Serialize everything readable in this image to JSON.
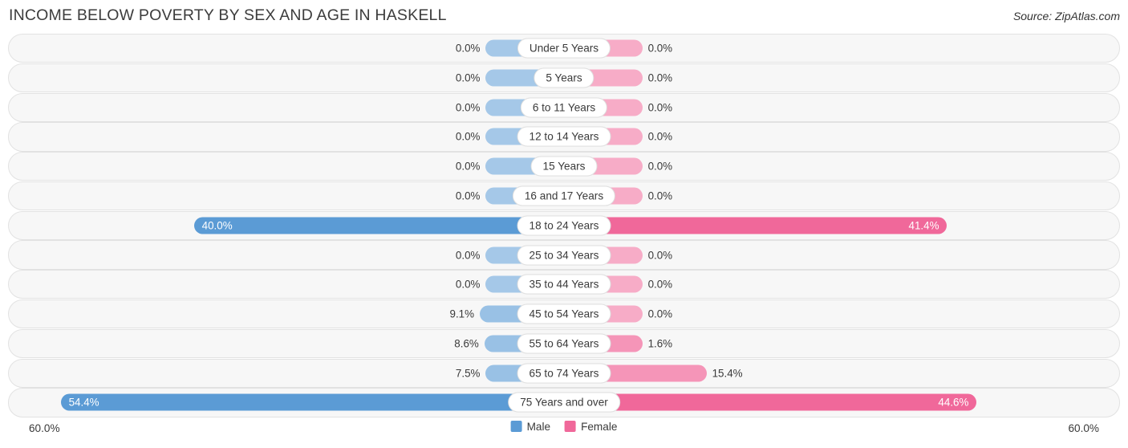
{
  "header": {
    "title": "Income Below Poverty by Sex and Age in Haskell",
    "source": "Source: ZipAtlas.com"
  },
  "axis": {
    "left_label": "60.0%",
    "right_label": "60.0%"
  },
  "legend": {
    "male": "Male",
    "female": "Female",
    "male_color": "#5b9bd5",
    "female_color": "#f0689a"
  },
  "chart_data": {
    "type": "bar",
    "title": "Income Below Poverty by Sex and Age in Haskell",
    "subtitle": "Source: ZipAtlas.com",
    "orientation": "horizontal-diverging",
    "xlabel": "",
    "ylabel": "",
    "xlim": [
      60.0,
      60.0
    ],
    "grid": false,
    "legend_position": "bottom-center",
    "categories": [
      "Under 5 Years",
      "5 Years",
      "6 to 11 Years",
      "12 to 14 Years",
      "15 Years",
      "16 and 17 Years",
      "18 to 24 Years",
      "25 to 34 Years",
      "35 to 44 Years",
      "45 to 54 Years",
      "55 to 64 Years",
      "65 to 74 Years",
      "75 Years and over"
    ],
    "series": [
      {
        "name": "Male",
        "color": "#5b9bd5",
        "values": [
          0.0,
          0.0,
          0.0,
          0.0,
          0.0,
          0.0,
          40.0,
          0.0,
          0.0,
          9.1,
          8.6,
          7.5,
          54.4
        ],
        "labels": [
          "0.0%",
          "0.0%",
          "0.0%",
          "0.0%",
          "0.0%",
          "0.0%",
          "40.0%",
          "0.0%",
          "0.0%",
          "9.1%",
          "8.6%",
          "7.5%",
          "54.4%"
        ]
      },
      {
        "name": "Female",
        "color": "#f0689a",
        "values": [
          0.0,
          0.0,
          0.0,
          0.0,
          0.0,
          0.0,
          41.4,
          0.0,
          0.0,
          0.0,
          1.6,
          15.4,
          44.6
        ],
        "labels": [
          "0.0%",
          "0.0%",
          "0.0%",
          "0.0%",
          "0.0%",
          "0.0%",
          "41.4%",
          "0.0%",
          "0.0%",
          "0.0%",
          "1.6%",
          "15.4%",
          "44.6%"
        ]
      }
    ]
  }
}
